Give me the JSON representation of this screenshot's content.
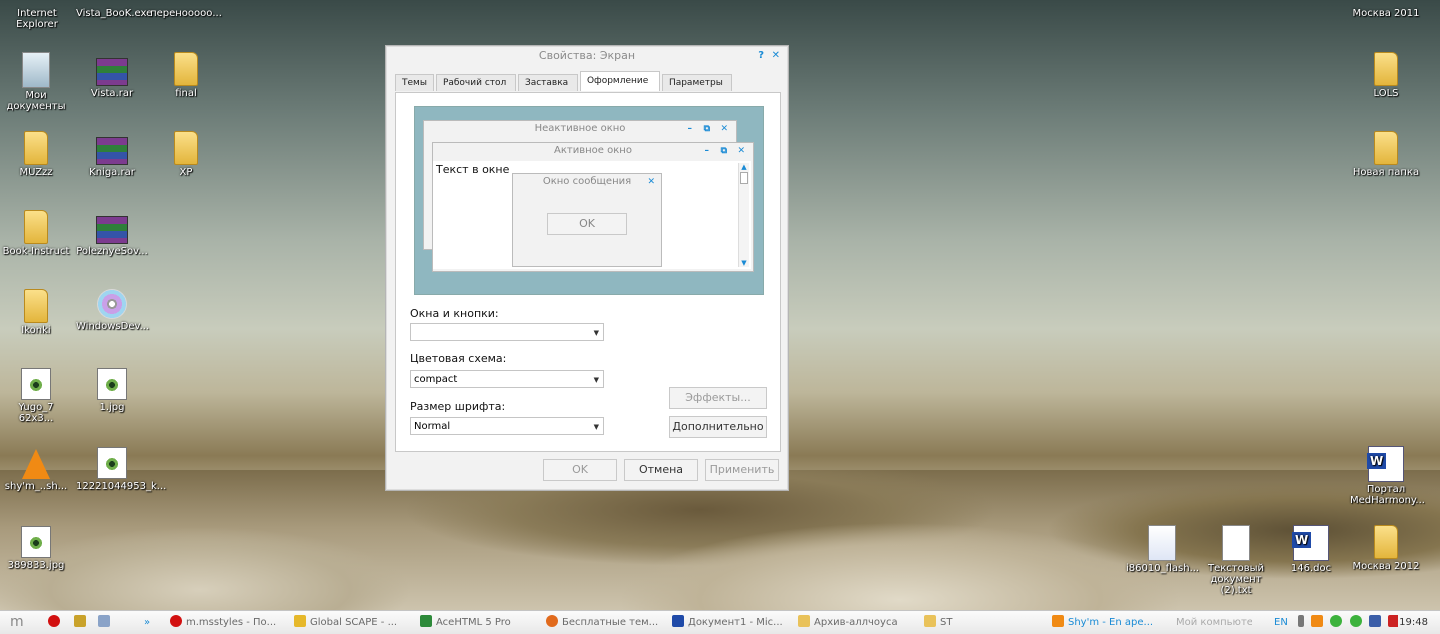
{
  "desktop": {
    "icons": [
      {
        "label": "Internet Explorer",
        "kind": "ie",
        "x": 0,
        "y": 0
      },
      {
        "label": "Vista_BooK.exe",
        "kind": "exe"
      },
      {
        "label": "перенооооо...",
        "kind": "folder"
      },
      {
        "label": "Мои документы",
        "kind": "mydocs"
      },
      {
        "label": "Vista.rar",
        "kind": "rar"
      },
      {
        "label": "final",
        "kind": "folder"
      },
      {
        "label": "MUZzz",
        "kind": "folder"
      },
      {
        "label": "Kniga.rar",
        "kind": "rar"
      },
      {
        "label": "XP",
        "kind": "folder"
      },
      {
        "label": "Book-Instruct",
        "kind": "folder"
      },
      {
        "label": "PoleznyeSov...",
        "kind": "rar"
      },
      {
        "label": "Ikonki",
        "kind": "folder"
      },
      {
        "label": "WindowsDev...",
        "kind": "cd"
      },
      {
        "label": "Yugo_7 62x3...",
        "kind": "image"
      },
      {
        "label": "1.jpg",
        "kind": "image"
      },
      {
        "label": "shy'm_..sh...",
        "kind": "vlc"
      },
      {
        "label": "12221044953_k...",
        "kind": "image"
      },
      {
        "label": "389833.jpg",
        "kind": "image"
      },
      {
        "label": "Москва 2011",
        "kind": "text"
      },
      {
        "label": "LOLS",
        "kind": "folder"
      },
      {
        "label": "Новая папка",
        "kind": "folder"
      },
      {
        "label": "Портал MedHarmony...",
        "kind": "word"
      },
      {
        "label": "i86010_flash...",
        "kind": "doc"
      },
      {
        "label": "Текстовый документ (2).txt",
        "kind": "txt"
      },
      {
        "label": "146.doc",
        "kind": "word"
      },
      {
        "label": "Москва 2012",
        "kind": "folder"
      }
    ]
  },
  "dialog": {
    "title": "Свойства: Экран",
    "help_btn": "?",
    "close_btn": "✕",
    "tabs": [
      "Темы",
      "Рабочий стол",
      "Заставка",
      "Оформление",
      "Параметры"
    ],
    "active_tab": "Оформление",
    "preview": {
      "inactive_title": "Неактивное окно",
      "active_title": "Активное окно",
      "window_text": "Текст в окне",
      "message_title": "Окно сообщения",
      "ok_label": "OK"
    },
    "windows_buttons_label": "Окна и кнопки:",
    "windows_buttons_value": "",
    "color_scheme_label": "Цветовая схема:",
    "color_scheme_value": "compact",
    "font_size_label": "Размер шрифта:",
    "font_size_value": "Normal",
    "effects_button": "Эффекты...",
    "advanced_button": "Дополнительно",
    "ok_button": "OK",
    "cancel_button": "Отмена",
    "apply_button": "Применить"
  },
  "taskbar": {
    "start_label": "m",
    "items": [
      "m.msstyles - По...",
      "Global SCAPE - ...",
      "AceHTML 5 Pro",
      "Бесплатные тем...",
      "Документ1 - Mic...",
      "Архив-аллчоуса",
      "ST",
      "Shy'm - En ape...",
      "Мой компьютер"
    ],
    "language": "EN",
    "time": "19:48"
  }
}
